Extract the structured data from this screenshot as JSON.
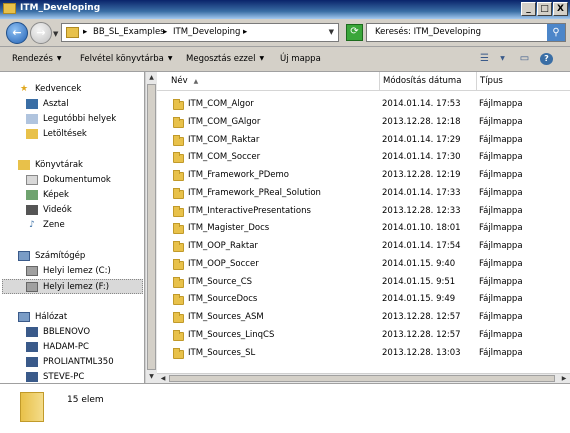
{
  "window": {
    "title": "ITM_Developing",
    "controls": {
      "minimize": "_",
      "maximize": "□",
      "close": "X"
    }
  },
  "address_bar": {
    "back_icon": "back-arrow-icon",
    "forward_icon": "forward-arrow-icon",
    "path_segments": [
      "BB_SL_Examples",
      "ITM_Developing"
    ],
    "path_separator": "▸",
    "refresh_icon": "refresh-icon",
    "search_text": "Keresés: ITM_Developing"
  },
  "command_bar": {
    "organize": "Rendezés",
    "include_library": "Felvétel könyvtárba",
    "share": "Megosztás ezzel",
    "new_folder": "Új mappa"
  },
  "nav_pane": {
    "favorites": {
      "label": "Kedvencek",
      "items": [
        "Asztal",
        "Legutóbbi helyek",
        "Letöltések"
      ]
    },
    "libraries": {
      "label": "Könyvtárak",
      "items": [
        "Dokumentumok",
        "Képek",
        "Videók",
        "Zene"
      ]
    },
    "computer": {
      "label": "Számítógép",
      "items": [
        "Helyi lemez (C:)",
        "Helyi lemez (F:)"
      ],
      "selected": "Helyi lemez (F:)"
    },
    "network": {
      "label": "Hálózat",
      "items": [
        "BBLENOVO",
        "HADAM-PC",
        "PROLIANTML350",
        "STEVE-PC"
      ]
    }
  },
  "columns": {
    "name": "Név",
    "modified": "Módosítás dátuma",
    "type": "Típus"
  },
  "files": [
    {
      "name": "ITM_COM_Algor",
      "modified": "2014.01.14. 17:53",
      "type": "Fájlmappa"
    },
    {
      "name": "ITM_COM_GAlgor",
      "modified": "2013.12.28. 12:18",
      "type": "Fájlmappa"
    },
    {
      "name": "ITM_COM_Raktar",
      "modified": "2014.01.14. 17:29",
      "type": "Fájlmappa"
    },
    {
      "name": "ITM_COM_Soccer",
      "modified": "2014.01.14. 17:30",
      "type": "Fájlmappa"
    },
    {
      "name": "ITM_Framework_PDemo",
      "modified": "2013.12.28. 12:19",
      "type": "Fájlmappa"
    },
    {
      "name": "ITM_Framework_PReal_Solution",
      "modified": "2014.01.14. 17:33",
      "type": "Fájlmappa"
    },
    {
      "name": "ITM_InteractivePresentations",
      "modified": "2013.12.28. 12:33",
      "type": "Fájlmappa"
    },
    {
      "name": "ITM_Magister_Docs",
      "modified": "2014.01.10. 18:01",
      "type": "Fájlmappa"
    },
    {
      "name": "ITM_OOP_Raktar",
      "modified": "2014.01.14. 17:54",
      "type": "Fájlmappa"
    },
    {
      "name": "ITM_OOP_Soccer",
      "modified": "2014.01.15. 9:40",
      "type": "Fájlmappa"
    },
    {
      "name": "ITM_Source_CS",
      "modified": "2014.01.15. 9:51",
      "type": "Fájlmappa"
    },
    {
      "name": "ITM_SourceDocs",
      "modified": "2014.01.15. 9:49",
      "type": "Fájlmappa"
    },
    {
      "name": "ITM_Sources_ASM",
      "modified": "2013.12.28. 12:57",
      "type": "Fájlmappa"
    },
    {
      "name": "ITM_Sources_LinqCS",
      "modified": "2013.12.28. 12:57",
      "type": "Fájlmappa"
    },
    {
      "name": "ITM_Sources_SL",
      "modified": "2013.12.28. 13:03",
      "type": "Fájlmappa"
    }
  ],
  "status": {
    "item_count": "15 elem"
  }
}
